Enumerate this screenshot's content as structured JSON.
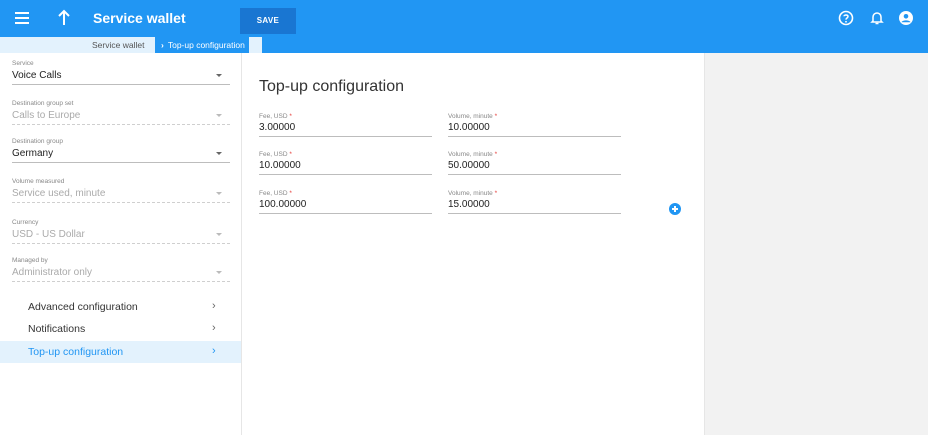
{
  "header": {
    "title": "Service wallet",
    "save_label": "SAVE"
  },
  "breadcrumb": {
    "root": "Service wallet",
    "current": "Top-up configuration"
  },
  "sidebar": {
    "fields": [
      {
        "label": "Service",
        "value": "Voice Calls",
        "disabled": false
      },
      {
        "label": "Destination group set",
        "value": "Calls to Europe",
        "disabled": true
      },
      {
        "label": "Destination group",
        "value": "Germany",
        "disabled": false
      },
      {
        "label": "Volume measured",
        "value": "Service used, minute",
        "disabled": true
      },
      {
        "label": "Currency",
        "value": "USD - US Dollar",
        "disabled": true
      },
      {
        "label": "Managed by",
        "value": "Administrator only",
        "disabled": true
      }
    ],
    "nav": [
      {
        "label": "Advanced configuration",
        "active": false
      },
      {
        "label": "Notifications",
        "active": false
      },
      {
        "label": "Top-up configuration",
        "active": true
      }
    ],
    "chevron": "›"
  },
  "main": {
    "title": "Top-up configuration",
    "required_mark": "*",
    "rows": [
      {
        "fee_label": "Fee, USD",
        "fee": "3.00000",
        "volume_label": "Volume, minute",
        "volume": "10.00000"
      },
      {
        "fee_label": "Fee, USD",
        "fee": "10.00000",
        "volume_label": "Volume, minute",
        "volume": "50.00000"
      },
      {
        "fee_label": "Fee, USD",
        "fee": "100.00000",
        "volume_label": "Volume, minute",
        "volume": "15.00000"
      }
    ]
  },
  "colors": {
    "brand": "#2196f3",
    "active_bg": "#e3f2fd",
    "required": "#e53935"
  }
}
